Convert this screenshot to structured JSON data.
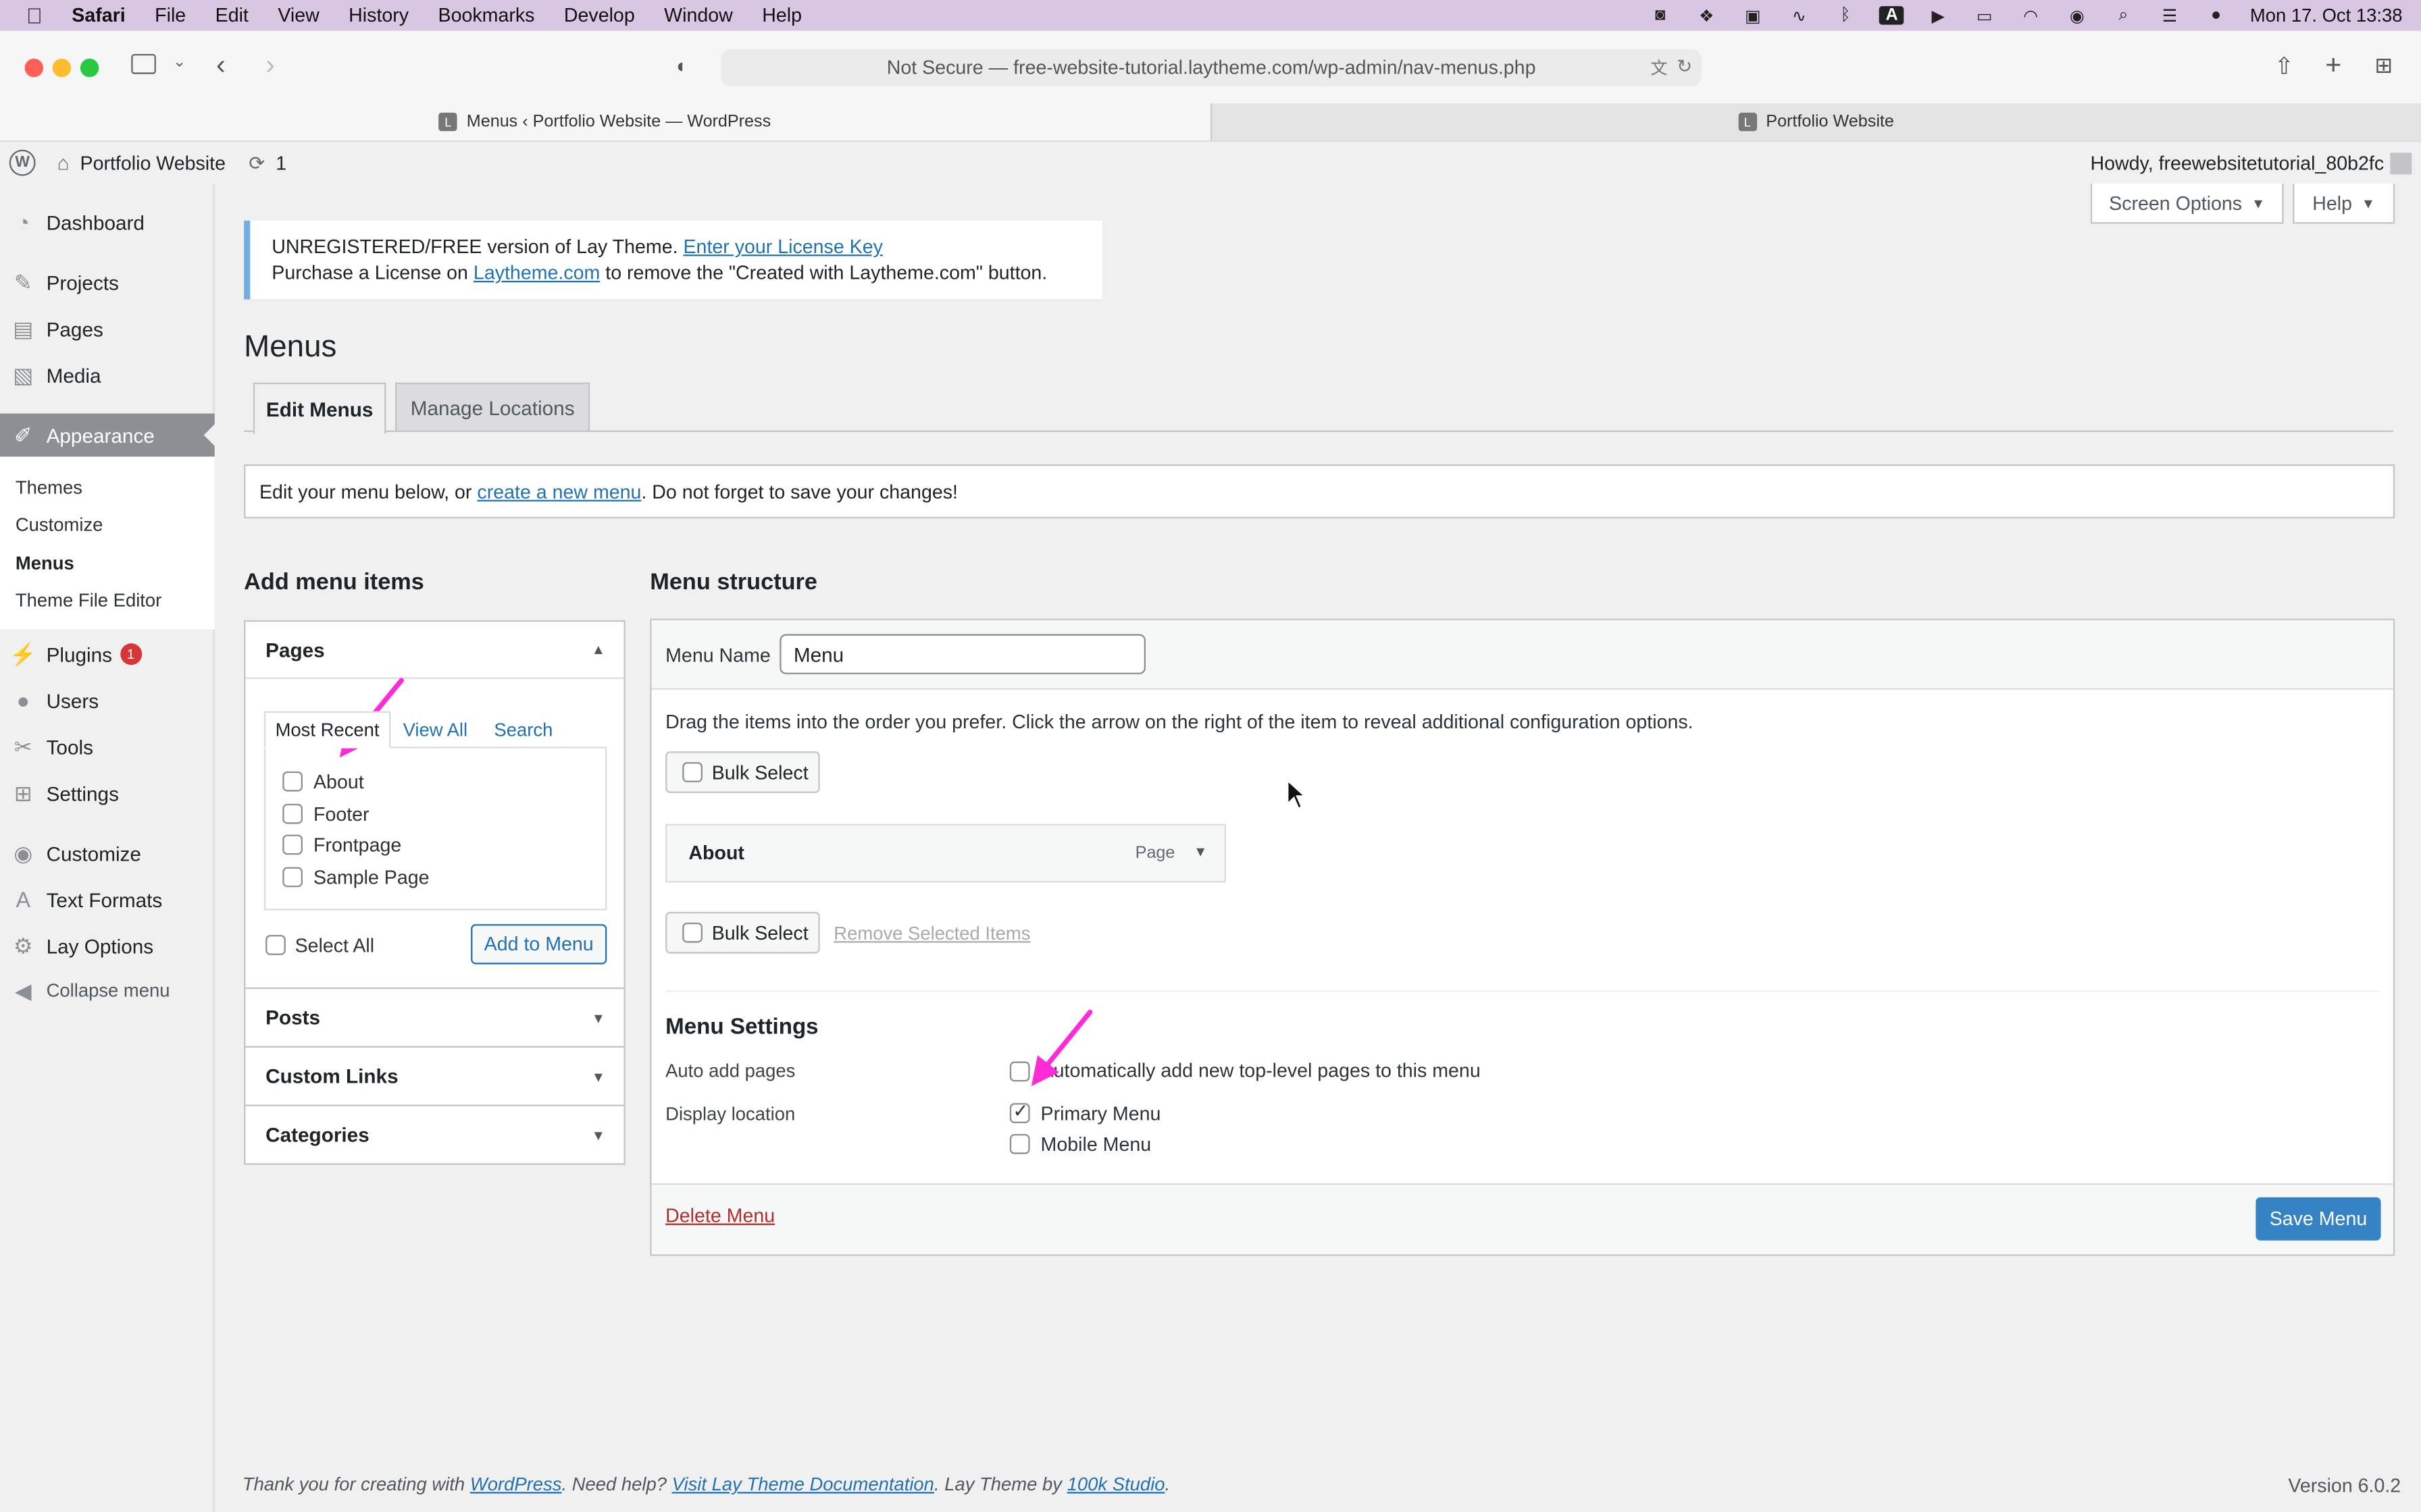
{
  "mac_menubar": {
    "app": "Safari",
    "menus": [
      "File",
      "Edit",
      "View",
      "History",
      "Bookmarks",
      "Develop",
      "Window",
      "Help"
    ],
    "clock": "Mon 17. Oct  13:38"
  },
  "browser": {
    "url": "Not Secure — free-website-tutorial.laytheme.com/wp-admin/nav-menus.php",
    "tabs": [
      {
        "title": "Menus ‹ Portfolio Website — WordPress",
        "favicon": "L"
      },
      {
        "title": "Portfolio Website",
        "favicon": "L"
      }
    ]
  },
  "adminbar": {
    "site_name": "Portfolio Website",
    "updates_count": "1",
    "howdy": "Howdy, freewebsitetutorial_80b2fc"
  },
  "sidebar": {
    "dashboard": "Dashboard",
    "projects": "Projects",
    "pages": "Pages",
    "media": "Media",
    "appearance": "Appearance",
    "themes": "Themes",
    "customize_sub": "Customize",
    "menus": "Menus",
    "theme_file_editor": "Theme File Editor",
    "plugins": "Plugins",
    "plugins_badge": "1",
    "users": "Users",
    "tools": "Tools",
    "settings": "Settings",
    "customize": "Customize",
    "text_formats": "Text Formats",
    "lay_options": "Lay Options",
    "collapse": "Collapse menu"
  },
  "top_buttons": {
    "screen_options": "Screen Options",
    "help": "Help"
  },
  "notice": {
    "line1_prefix": "UNREGISTERED/FREE version of Lay Theme.",
    "line1_link": "Enter your License Key",
    "line2_prefix": "Purchase a License on",
    "line2_link": "Laytheme.com",
    "line2_suffix": "to remove the \"Created with Laytheme.com\" button."
  },
  "page_title": "Menus",
  "nav_tabs": {
    "edit": "Edit Menus",
    "manage": "Manage Locations"
  },
  "edit_notice": {
    "prefix": "Edit your menu below, or",
    "link": "create a new menu",
    "suffix": ". Do not forget to save your changes!"
  },
  "add_items": {
    "heading": "Add menu items",
    "pages_title": "Pages",
    "tabs": [
      "Most Recent",
      "View All",
      "Search"
    ],
    "pages": [
      "About",
      "Footer",
      "Frontpage",
      "Sample Page"
    ],
    "select_all": "Select All",
    "add_button": "Add to Menu",
    "posts": "Posts",
    "custom_links": "Custom Links",
    "categories": "Categories"
  },
  "structure": {
    "heading": "Menu structure",
    "menu_name_label": "Menu Name",
    "menu_name_value": "Menu",
    "instructions": "Drag the items into the order you prefer. Click the arrow on the right of the item to reveal additional configuration options.",
    "bulk_select": "Bulk Select",
    "item_title": "About",
    "item_type": "Page",
    "remove_selected": "Remove Selected Items",
    "settings_heading": "Menu Settings",
    "auto_add_label": "Auto add pages",
    "auto_add_text": "Automatically add new top-level pages to this menu",
    "display_location_label": "Display location",
    "primary_menu": "Primary Menu",
    "mobile_menu": "Mobile Menu",
    "delete_menu": "Delete Menu",
    "save_menu": "Save Menu"
  },
  "footer": {
    "prefix": "Thank you for creating with",
    "wp_link": "WordPress",
    "mid": ". Need help?",
    "doc_link": "Visit Lay Theme Documentation",
    "mid2": ". Lay Theme by",
    "studio_link": "100k Studio",
    "end": ".",
    "version": "Version 6.0.2"
  },
  "colors": {
    "accent": "#2271b1",
    "save_button": "#3582c4",
    "annotation_arrow": "#ff2bd6",
    "badge": "#d63638",
    "menubar": "#d9c6e3"
  }
}
